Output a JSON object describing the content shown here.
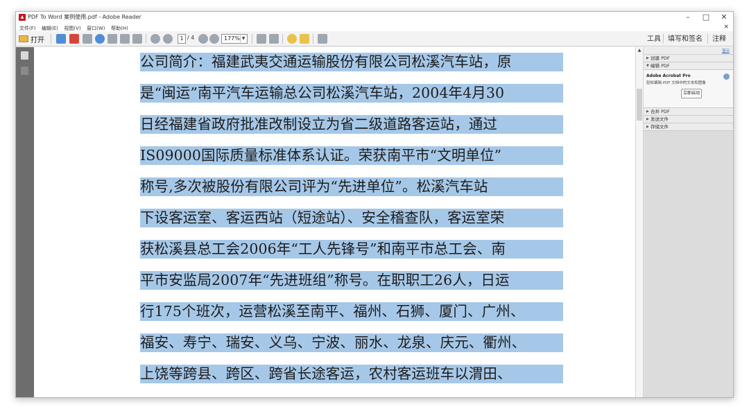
{
  "window": {
    "title": "PDF To Word 案例使用.pdf - Adobe Reader",
    "controls": {
      "minimize": "–",
      "maximize": "□",
      "close": "✕"
    }
  },
  "menubar": {
    "items": [
      "文件(F)",
      "编辑(E)",
      "视图(V)",
      "窗口(W)",
      "帮助(H)"
    ],
    "doc_close": "×"
  },
  "toolbar": {
    "open_label": "打开",
    "page_current": "1",
    "page_total": "/ 4",
    "zoom": "177%",
    "tabs": [
      "工具",
      "填写和签名",
      "注释"
    ]
  },
  "document": {
    "lines": [
      "公司简介：福建武夷交通运输股份有限公司松溪汽车站，原",
      "是“闽运”南平汽车运输总公司松溪汽车站，2004年4月30",
      "日经福建省政府批准改制设立为省二级道路客运站，通过",
      "IS09000国际质量标准体系认证。荣获南平市“文明单位”",
      "称号,多次被股份有限公司评为“先进单位”。松溪汽车站",
      "下设客运室、客运西站（短途站）、安全稽查队，客运室荣",
      "获松溪县总工会2006年“工人先锋号”和南平市总工会、南",
      "平市安监局2007年“先进班组”称号。在职职工26人，日运",
      "行175个班次，运营松溪至南平、福州、石狮、厦门、广州、",
      "福安、寿宁、瑞安、义乌、宁波、丽水、龙泉、庆元、衢州、",
      "上饶等跨县、跨区、跨省长途客运，农村客运班车以渭田、"
    ],
    "selection_color": "#a6c8e8"
  },
  "right_pane": {
    "top_link": "显示",
    "sections_top": [
      "创建 PDF",
      "编辑 PDF"
    ],
    "promo": {
      "title": "Adobe Acrobat Pro",
      "description": "轻松编辑 PDF 文档中的文本和图像",
      "button": "立即启动"
    },
    "sections_bottom": [
      "合并 PDF",
      "发送文件",
      "存储文件"
    ]
  }
}
